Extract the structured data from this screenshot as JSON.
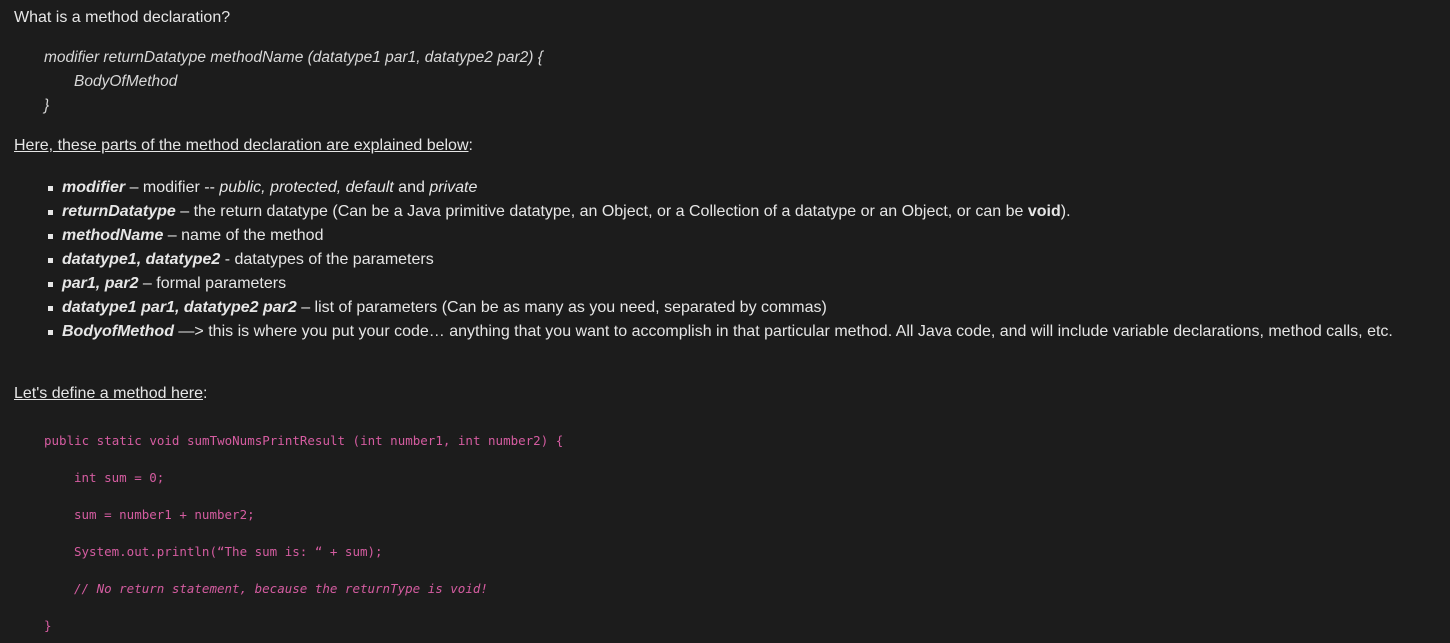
{
  "heading": "What is a method declaration?",
  "signature": {
    "line1": "modifier returnDatatype methodName (datatype1 par1, datatype2 par2) {",
    "line2": "BodyOfMethod",
    "line3": "}"
  },
  "explain_link": "Here, these parts of the method declaration are explained below",
  "explain_colon": ":",
  "bullets": [
    {
      "term": "modifier",
      "parts": [
        " – modifier -- ",
        "public, protected, default",
        " and ",
        "private"
      ]
    },
    {
      "term": "returnDatatype",
      "parts": [
        " – the return datatype (Can be a Java primitive datatype,  an Object, or a Collection of a datatype or an Object, or can be ",
        "void",
        ")."
      ]
    },
    {
      "term": "methodName",
      "text": " – name of the method"
    },
    {
      "term": "datatype1, datatype2",
      "text": " - datatypes of the parameters"
    },
    {
      "term": "par1, par2",
      "text": " – formal parameters"
    },
    {
      "term": "datatype1 par1, datatype2 par2",
      "text": " – list of parameters (Can be as many as you need, separated by commas)"
    },
    {
      "term": "BodyofMethod",
      "text": " —> this is where you put your code… anything that you want to accomplish in that particular method.  All Java code, and will include variable declarations, method calls, etc."
    }
  ],
  "define_link": "Let's define a method here",
  "define_colon": ":",
  "code": {
    "line1": "public static void sumTwoNumsPrintResult (int number1, int number2) {",
    "line2": "int sum = 0;",
    "line3": "sum = number1 + number2;",
    "line4": "System.out.println(“The sum is: “ + sum);",
    "line5": "// No return statement, because the returnType is void!",
    "line6": "}"
  },
  "colors": {
    "background": "#1c1c1c",
    "text": "#e6e6e6",
    "code": "#d45ca0"
  }
}
